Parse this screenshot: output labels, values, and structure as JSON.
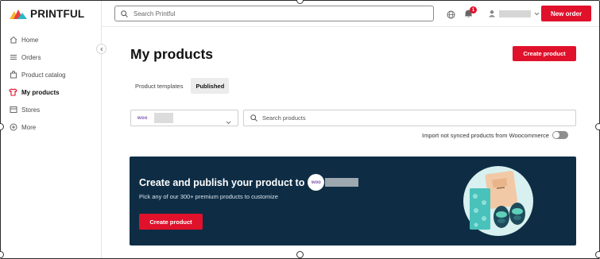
{
  "brand": {
    "name": "PRINTFUL"
  },
  "sidebar": {
    "items": [
      {
        "label": "Home",
        "icon": "home-icon"
      },
      {
        "label": "Orders",
        "icon": "list-icon"
      },
      {
        "label": "Product catalog",
        "icon": "bag-icon"
      },
      {
        "label": "My products",
        "icon": "tshirt-icon",
        "active": true
      },
      {
        "label": "Stores",
        "icon": "store-icon"
      },
      {
        "label": "More",
        "icon": "plus-circle-icon"
      }
    ]
  },
  "topbar": {
    "search_placeholder": "Search Printful",
    "notification_count": "1",
    "new_order_label": "New order"
  },
  "main": {
    "title": "My products",
    "create_product_label": "Create product",
    "tabs": [
      {
        "label": "Product templates",
        "active": false
      },
      {
        "label": "Published",
        "active": true
      }
    ],
    "store_logo_text": "woo",
    "search_placeholder": "Search products",
    "sync_toggle_label": "Import not synced products from Woocommerce",
    "banner": {
      "title": "Create and publish your product to",
      "logo_text": "woo",
      "subtitle": "Pick any of our 300+ premium products to customize",
      "button_label": "Create product"
    }
  },
  "colors": {
    "accent": "#e0112b",
    "banner_bg": "#0e2d45",
    "woo_purple": "#7f54b3"
  }
}
